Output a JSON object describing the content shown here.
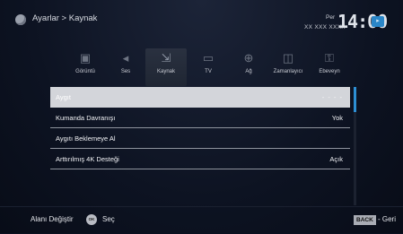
{
  "header": {
    "breadcrumb": "Ayarlar > Kaynak",
    "day": "Per",
    "date": "XX XXX XXXX",
    "time": "14:00"
  },
  "categories": [
    {
      "label": "Görüntü",
      "icon": "picture-icon"
    },
    {
      "label": "Ses",
      "icon": "sound-icon"
    },
    {
      "label": "Kaynak",
      "icon": "source-icon"
    },
    {
      "label": "TV",
      "icon": "tv-icon"
    },
    {
      "label": "Ağ",
      "icon": "network-icon"
    },
    {
      "label": "Zamanlayıcı",
      "icon": "timer-icon"
    },
    {
      "label": "Ebeveyn",
      "icon": "parental-icon"
    }
  ],
  "list": [
    {
      "label": "Aygıt",
      "value": "- - - -"
    },
    {
      "label": "Kumanda Davranışı",
      "value": "Yok"
    },
    {
      "label": "Aygıtı Beklemeye Al",
      "value": ""
    },
    {
      "label": "Arttırılmış 4K Desteği",
      "value": "Açık"
    }
  ],
  "footer": {
    "left": "Alanı Değiştir",
    "ok_icon": "OK",
    "ok_label": "Seç",
    "back_key": "BACK",
    "back_label": "- Geri"
  },
  "colors": {
    "selection": "#d3d5da",
    "accent": "#2d8fd4"
  }
}
